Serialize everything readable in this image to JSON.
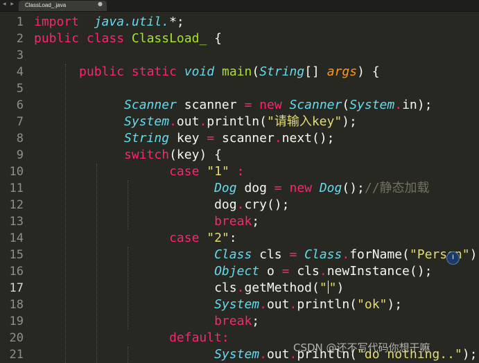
{
  "tabs": {
    "active_label": "ClassLoad_.java",
    "nav_arrows": "◂ ▸",
    "close_glyph": "●"
  },
  "editor": {
    "current_line": 17,
    "lines": [
      {
        "num": "1",
        "tokens": [
          [
            "k",
            "import"
          ],
          [
            "",
            "  "
          ],
          [
            "t",
            "java.util."
          ],
          [
            "",
            "*;"
          ]
        ]
      },
      {
        "num": "2",
        "tokens": [
          [
            "k",
            "public"
          ],
          [
            "",
            " "
          ],
          [
            "k",
            "class"
          ],
          [
            "",
            " "
          ],
          [
            "f",
            "ClassLoad_"
          ],
          [
            "",
            " {"
          ]
        ]
      },
      {
        "num": "3",
        "tokens": []
      },
      {
        "num": "4",
        "tokens": [
          [
            "",
            "      "
          ],
          [
            "k",
            "public"
          ],
          [
            "",
            " "
          ],
          [
            "k",
            "static"
          ],
          [
            "",
            " "
          ],
          [
            "t",
            "void"
          ],
          [
            "",
            " "
          ],
          [
            "f",
            "main"
          ],
          [
            "",
            "("
          ],
          [
            "t",
            "String"
          ],
          [
            "",
            "[] "
          ],
          [
            "p",
            "args"
          ],
          [
            "",
            ") {"
          ]
        ]
      },
      {
        "num": "5",
        "tokens": []
      },
      {
        "num": "6",
        "tokens": [
          [
            "",
            "            "
          ],
          [
            "t",
            "Scanner"
          ],
          [
            "",
            " scanner "
          ],
          [
            "o",
            "="
          ],
          [
            "",
            " "
          ],
          [
            "k",
            "new"
          ],
          [
            "",
            " "
          ],
          [
            "t",
            "Scanner"
          ],
          [
            "",
            "("
          ],
          [
            "t",
            "System"
          ],
          [
            "o",
            "."
          ],
          [
            "",
            "in);"
          ]
        ]
      },
      {
        "num": "7",
        "tokens": [
          [
            "",
            "            "
          ],
          [
            "t",
            "System"
          ],
          [
            "o",
            "."
          ],
          [
            "",
            "out"
          ],
          [
            "o",
            "."
          ],
          [
            "",
            "println("
          ],
          [
            "s",
            "\"请输入key\""
          ],
          [
            "",
            ");"
          ]
        ]
      },
      {
        "num": "8",
        "tokens": [
          [
            "",
            "            "
          ],
          [
            "t",
            "String"
          ],
          [
            "",
            " key "
          ],
          [
            "o",
            "="
          ],
          [
            "",
            " scanner"
          ],
          [
            "o",
            "."
          ],
          [
            "",
            "next();"
          ]
        ]
      },
      {
        "num": "9",
        "tokens": [
          [
            "",
            "            "
          ],
          [
            "k",
            "switch"
          ],
          [
            "",
            "(key) {"
          ]
        ]
      },
      {
        "num": "10",
        "tokens": [
          [
            "",
            "                  "
          ],
          [
            "k",
            "case"
          ],
          [
            "",
            " "
          ],
          [
            "s",
            "\"1\""
          ],
          [
            "",
            " "
          ],
          [
            "k",
            ":"
          ]
        ]
      },
      {
        "num": "11",
        "tokens": [
          [
            "",
            "                        "
          ],
          [
            "t",
            "Dog"
          ],
          [
            "",
            " dog "
          ],
          [
            "o",
            "="
          ],
          [
            "",
            " "
          ],
          [
            "k",
            "new"
          ],
          [
            "",
            " "
          ],
          [
            "t",
            "Dog"
          ],
          [
            "",
            "();"
          ],
          [
            "c",
            "//静态加载"
          ]
        ]
      },
      {
        "num": "12",
        "tokens": [
          [
            "",
            "                        dog"
          ],
          [
            "o",
            "."
          ],
          [
            "",
            "cry();"
          ]
        ]
      },
      {
        "num": "13",
        "tokens": [
          [
            "",
            "                        "
          ],
          [
            "k",
            "break"
          ],
          [
            "",
            ";"
          ]
        ]
      },
      {
        "num": "14",
        "tokens": [
          [
            "",
            "                  "
          ],
          [
            "k",
            "case"
          ],
          [
            "",
            " "
          ],
          [
            "s",
            "\"2\""
          ],
          [
            "",
            ":"
          ]
        ]
      },
      {
        "num": "15",
        "tokens": [
          [
            "",
            "                        "
          ],
          [
            "t",
            "Class"
          ],
          [
            "",
            " cls "
          ],
          [
            "o",
            "="
          ],
          [
            "",
            " "
          ],
          [
            "t",
            "Class"
          ],
          [
            "o",
            "."
          ],
          [
            "",
            "forName("
          ],
          [
            "s",
            "\"Person\""
          ],
          [
            "",
            ");"
          ]
        ]
      },
      {
        "num": "16",
        "tokens": [
          [
            "",
            "                        "
          ],
          [
            "t",
            "Object"
          ],
          [
            "",
            " o "
          ],
          [
            "o",
            "="
          ],
          [
            "",
            " cls"
          ],
          [
            "o",
            "."
          ],
          [
            "",
            "newInstance();"
          ]
        ]
      },
      {
        "num": "17",
        "tokens": [
          [
            "",
            "                        cls"
          ],
          [
            "o",
            "."
          ],
          [
            "",
            "getMethod("
          ],
          [
            "s",
            "\""
          ],
          [
            "caret",
            ""
          ],
          [
            "s",
            "\""
          ],
          [
            "",
            ")"
          ]
        ]
      },
      {
        "num": "18",
        "tokens": [
          [
            "",
            "                        "
          ],
          [
            "t",
            "System"
          ],
          [
            "o",
            "."
          ],
          [
            "",
            "out"
          ],
          [
            "o",
            "."
          ],
          [
            "",
            "println("
          ],
          [
            "s",
            "\"ok\""
          ],
          [
            "",
            ");"
          ]
        ]
      },
      {
        "num": "19",
        "tokens": [
          [
            "",
            "                        "
          ],
          [
            "k",
            "break"
          ],
          [
            "",
            ";"
          ]
        ]
      },
      {
        "num": "20",
        "tokens": [
          [
            "",
            "                  "
          ],
          [
            "k",
            "default:"
          ]
        ]
      },
      {
        "num": "21",
        "tokens": [
          [
            "",
            "                        "
          ],
          [
            "t",
            "System"
          ],
          [
            "o",
            "."
          ],
          [
            "",
            "out"
          ],
          [
            "o",
            "."
          ],
          [
            "",
            "println("
          ],
          [
            "s",
            "\"do nothing..\""
          ],
          [
            "",
            ");"
          ]
        ]
      }
    ]
  },
  "hint_icon_glyph": "I",
  "watermark": "CSDN @还不写代码你想干嘛"
}
